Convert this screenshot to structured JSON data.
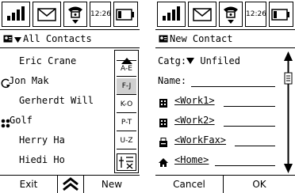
{
  "status_bar": {
    "time": "12:26",
    "icons": [
      "signal-strength-icon",
      "envelope-icon",
      "phone-icon",
      "battery-icon"
    ]
  },
  "contacts_screen": {
    "title": "All Contacts",
    "contacts": [
      {
        "name": "Eric Crane",
        "icon": ""
      },
      {
        "name": "Jon Mak",
        "icon": "callback-icon"
      },
      {
        "name": "Gerherdt Will",
        "icon": ""
      },
      {
        "name": "Golf",
        "icon": "group-icon"
      },
      {
        "name": "Herry Ha",
        "icon": ""
      },
      {
        "name": "Hiedi Ho",
        "icon": ""
      }
    ],
    "index": [
      "A-E",
      "F-J",
      "K-O",
      "P-T",
      "U-Z"
    ],
    "selected_index": "F-J",
    "softkeys": {
      "left": "Exit",
      "right": "New"
    }
  },
  "new_contact_screen": {
    "title": "New Contact",
    "category_label": "Catg:",
    "category_value": "Unfiled",
    "name_label": "Name:",
    "fields": [
      {
        "label": "<Work1>",
        "icon": "building-icon"
      },
      {
        "label": "<Work2>",
        "icon": "building-icon"
      },
      {
        "label": "<WorkFax>",
        "icon": "fax-icon"
      },
      {
        "label": "<Home>",
        "icon": "home-icon"
      }
    ],
    "softkeys": {
      "left": "Cancel",
      "right": "OK"
    }
  }
}
